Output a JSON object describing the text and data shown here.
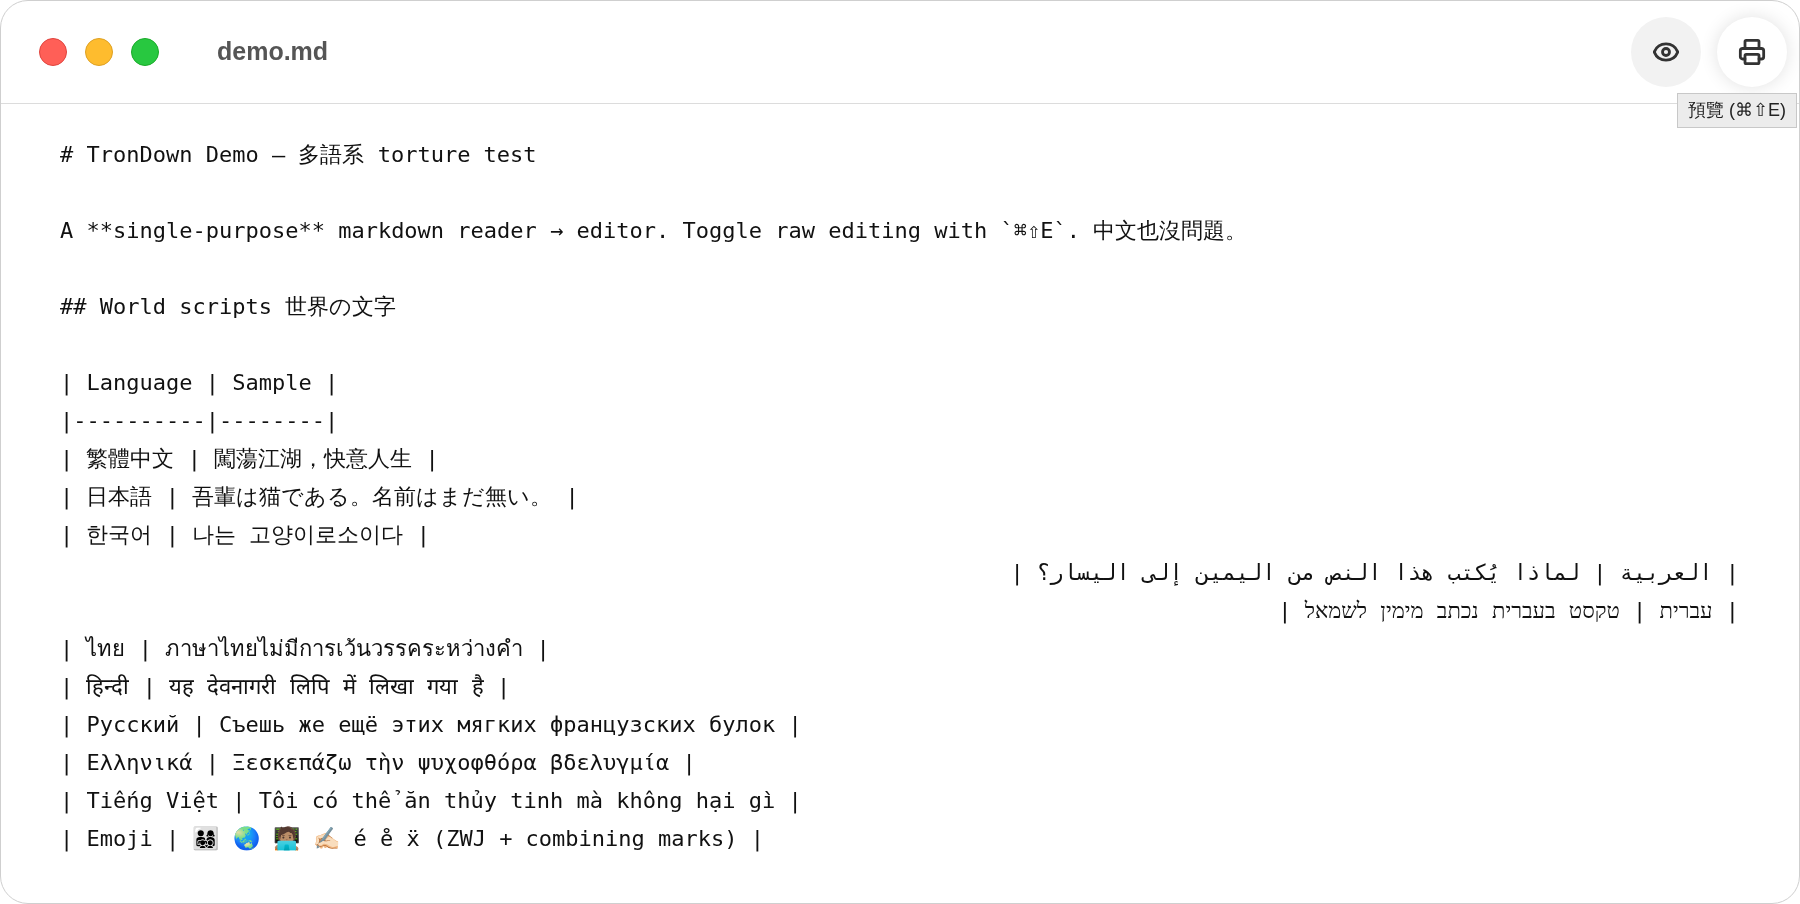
{
  "window": {
    "title": "demo.md"
  },
  "toolbar": [
    {
      "kind": "eye",
      "highlighted": true
    },
    {
      "kind": "print",
      "highlighted": false
    }
  ],
  "tooltip": {
    "text": "預覽 (⌘⇧E)"
  },
  "lines": [
    {
      "kind": "ltr",
      "text": "# TronDown Demo — 多語系 torture test"
    },
    {
      "kind": "blank"
    },
    {
      "kind": "ltr",
      "text": "A **single-purpose** markdown reader → editor. Toggle raw editing with `⌘⇧E`. 中文也沒問題。"
    },
    {
      "kind": "blank"
    },
    {
      "kind": "ltr",
      "text": "## World scripts 世界の文字"
    },
    {
      "kind": "blank"
    },
    {
      "kind": "ltr",
      "text": "| Language | Sample |"
    },
    {
      "kind": "ltr",
      "text": "|----------|--------|"
    },
    {
      "kind": "ltr",
      "text": "| 繁體中文 | 闖蕩江湖，快意人生 |"
    },
    {
      "kind": "ltr",
      "text": "| 日本語 | 吾輩は猫である。名前はまだ無い。 |"
    },
    {
      "kind": "ltr",
      "text": "| 한국어 | 나는 고양이로소이다 |"
    },
    {
      "kind": "rtl",
      "text": "| العربية | لماذا يُكتب هذا النص من اليمين إلى اليسار؟ |"
    },
    {
      "kind": "rtl",
      "text": "| עברית | טקסט בעברית נכתב מימין לשמאל |"
    },
    {
      "kind": "ltr",
      "text": "| ไทย | ภาษาไทยไม่มีการเว้นวรรคระหว่างคำ |"
    },
    {
      "kind": "ltr",
      "text": "| हिन्दी | यह देवनागरी लिपि में लिखा गया है |"
    },
    {
      "kind": "ltr",
      "text": "| Русский | Съешь же ещё этих мягких французских булок |"
    },
    {
      "kind": "ltr",
      "text": "| Ελληνικά | Ξεσκεπάζω τὴν ψυχοφθόρα βδελυγμία |"
    },
    {
      "kind": "ltr",
      "text": "| Tiếng Việt | Tôi có thể ăn thủy tinh mà không hại gì |"
    },
    {
      "kind": "ltr",
      "text": "| Emoji | 👨‍👩‍👧‍👦 🌏 🧑🏽‍💻 ✍🏻 é e̊ ẍ (ZWJ + combining marks) |"
    }
  ]
}
